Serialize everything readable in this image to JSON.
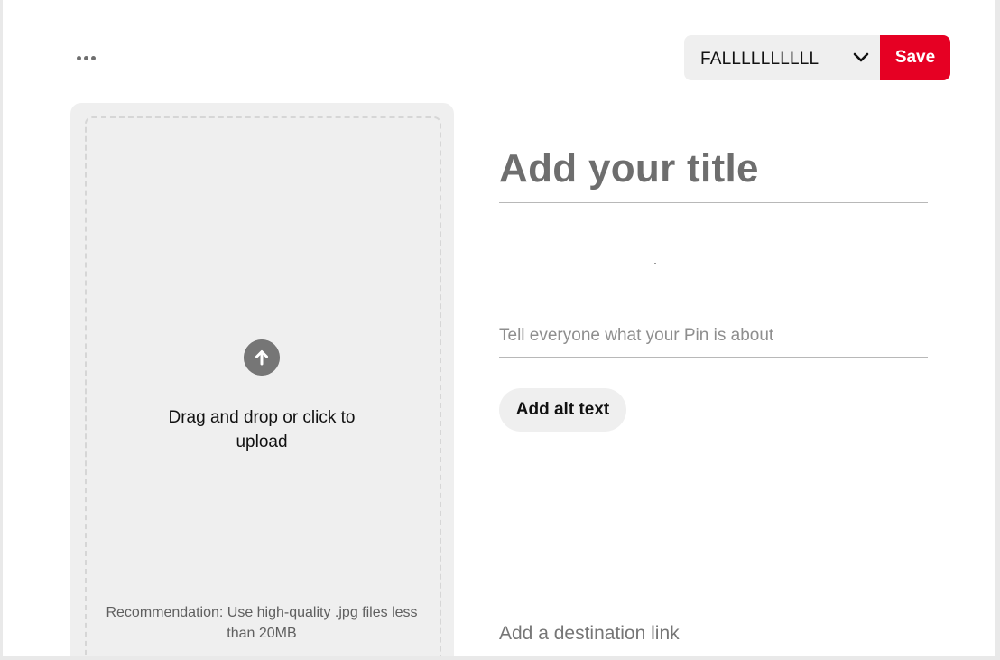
{
  "header": {
    "more_options_icon": "ellipsis-icon",
    "board_select": {
      "selected_board": "FALLLLLLLLLL",
      "chevron_icon": "chevron-down-icon"
    },
    "save_label": "Save"
  },
  "upload": {
    "icon": "arrow-up-circle-icon",
    "prompt": "Drag and drop or click to upload",
    "recommendation": "Recommendation: Use high-quality .jpg files less than 20MB"
  },
  "form": {
    "title_placeholder": "Add your title",
    "description_placeholder": "Tell everyone what your Pin is about",
    "alt_text_label": "Add alt text",
    "destination_link_placeholder": "Add a destination link"
  },
  "colors": {
    "accent": "#e60023",
    "panel_background": "#efefef",
    "placeholder_text": "#767676"
  }
}
